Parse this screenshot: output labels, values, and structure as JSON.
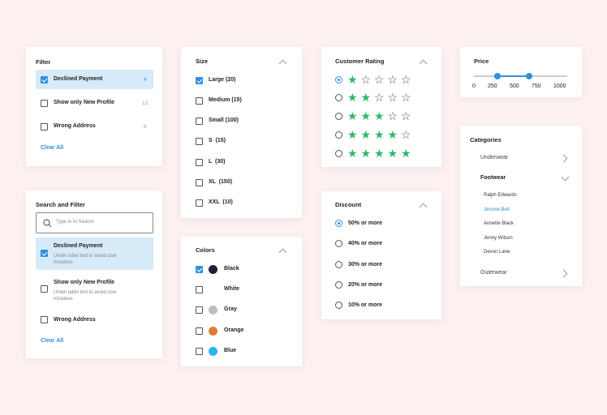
{
  "filter": {
    "title": "Filter",
    "items": [
      {
        "label": "Declined Payment",
        "count": "4",
        "checked": true
      },
      {
        "label": "Show only New Profile",
        "count": "12",
        "checked": false
      },
      {
        "label": "Wrong Address",
        "count": "6",
        "checked": false
      }
    ],
    "clear_label": "Clear All"
  },
  "search_filter": {
    "title": "Search and Filter",
    "placeholder": "Type in to Search",
    "items": [
      {
        "label": "Declined Payment",
        "sub": "Under label text to avoid user mistakes",
        "checked": true
      },
      {
        "label": "Show only New Profile",
        "sub": "Under label text to avoid user mistakes",
        "checked": false
      },
      {
        "label": "Wrong Address",
        "checked": false
      }
    ],
    "clear_label": "Clear All"
  },
  "size": {
    "title": "Size",
    "items": [
      {
        "label": "Large (20)",
        "checked": true
      },
      {
        "label": "Medium (15)",
        "checked": false
      },
      {
        "label": "Small (100)",
        "checked": false
      },
      {
        "label": "S  (15)",
        "checked": false
      },
      {
        "label": "L  (30)",
        "checked": false
      },
      {
        "label": "XL  (150)",
        "checked": false
      },
      {
        "label": "XXL  (10)",
        "checked": false
      }
    ]
  },
  "colors": {
    "title": "Colors",
    "items": [
      {
        "label": "Black",
        "color": "#1c2137",
        "checked": true
      },
      {
        "label": "White",
        "color": "#ffffff",
        "checked": false
      },
      {
        "label": "Gray",
        "color": "#bdbdbd",
        "checked": false
      },
      {
        "label": "Orange",
        "color": "#e07a3a",
        "checked": false
      },
      {
        "label": "Blue",
        "color": "#2bb4e8",
        "checked": false
      }
    ]
  },
  "rating": {
    "title": "Customer Rating",
    "rows": [
      {
        "stars": 1,
        "selected": true
      },
      {
        "stars": 2,
        "selected": false
      },
      {
        "stars": 3,
        "selected": false
      },
      {
        "stars": 4,
        "selected": false
      },
      {
        "stars": 5,
        "selected": false
      }
    ],
    "star_color": "#2cb86a"
  },
  "discount": {
    "title": "Discount",
    "items": [
      {
        "label": "50% or more",
        "selected": true
      },
      {
        "label": "40% or more",
        "selected": false
      },
      {
        "label": "30% or more",
        "selected": false
      },
      {
        "label": "20% or more",
        "selected": false
      },
      {
        "label": "10% or more",
        "selected": false
      }
    ]
  },
  "price": {
    "title": "Price",
    "ticks": [
      "0",
      "250",
      "500",
      "750",
      "1000"
    ],
    "range_min": 250,
    "range_max": 750,
    "accent": "#2f8fe0"
  },
  "categories": {
    "title": "Categories",
    "groups": [
      {
        "label": "Underwear",
        "expanded": false
      },
      {
        "label": "Footwear",
        "expanded": true
      },
      {
        "label": "Outerwear",
        "expanded": false
      }
    ],
    "footwear_items": [
      "Ralph Edwards",
      "Jerome Bell",
      "Annette Black",
      "Jenny Wilson",
      "Devon Lane"
    ],
    "active_item": "Jerome Bell"
  },
  "colors_accent": {
    "primary": "#2f8fe0",
    "highlight": "#d6eaf8",
    "background": "#fcf0f0"
  }
}
